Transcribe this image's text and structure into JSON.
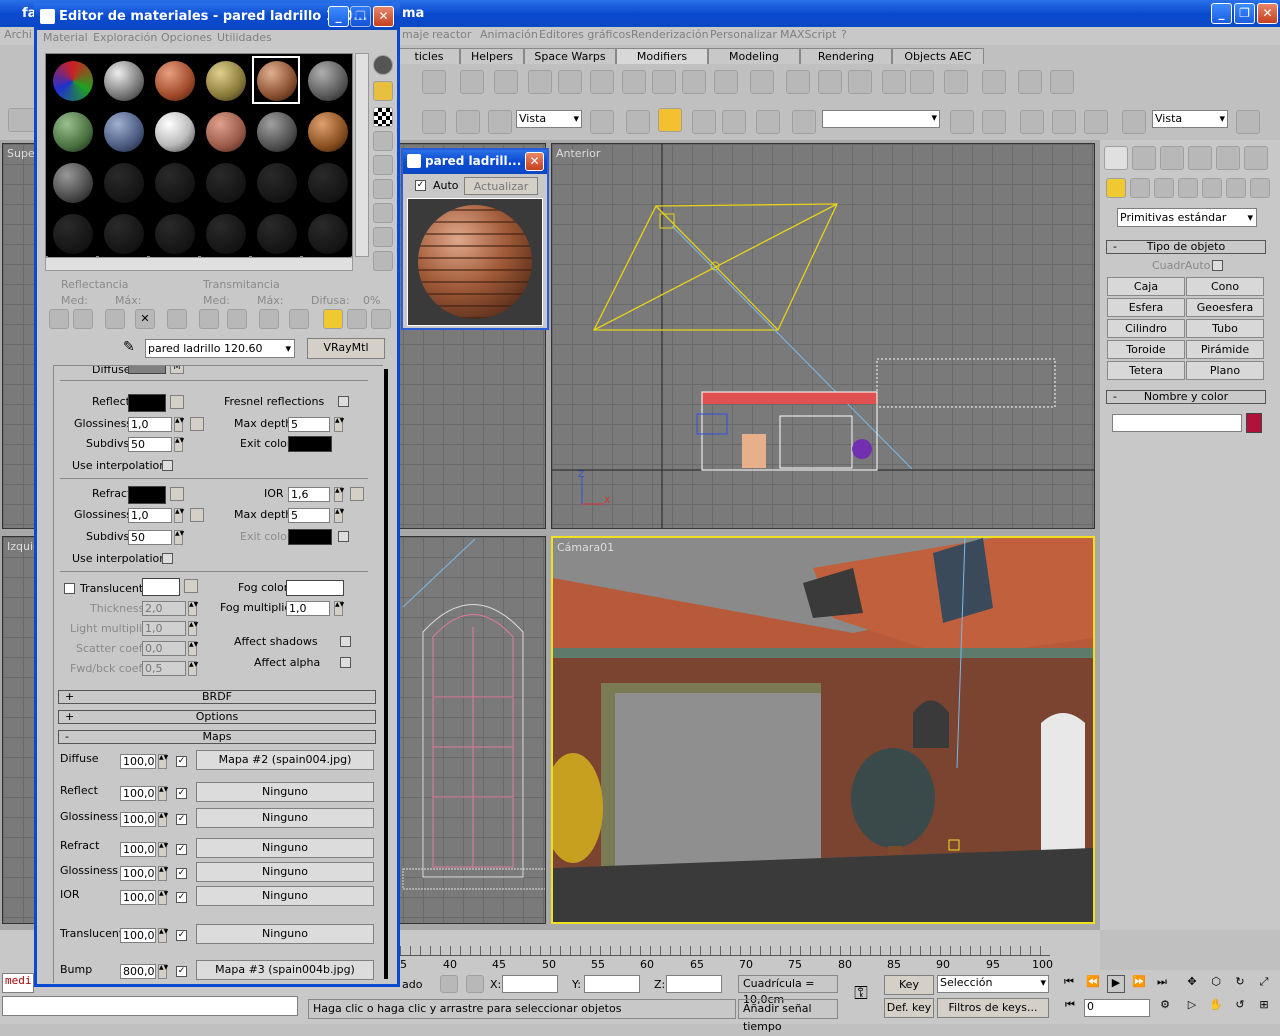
{
  "app": {
    "title_left": "fa",
    "title_right": "ma",
    "menu": [
      "Archi",
      "maje",
      "reactor",
      "Animación",
      "Editores gráficos",
      "Renderización",
      "Personalizar",
      "MAXScript",
      "?"
    ]
  },
  "tabs": [
    "ticles",
    "Helpers",
    "Space Warps",
    "Modifiers",
    "Modeling",
    "Rendering",
    "Objects AEC"
  ],
  "toolbar": {
    "view_select": "Vista",
    "view_select2": "Vista",
    "named_sel": ""
  },
  "viewports": {
    "top_left": "Super",
    "left": "Izquie",
    "front": "Anterior",
    "camera": "Cámara01",
    "axis_z": "Z",
    "axis_x": "X"
  },
  "cmdpanel": {
    "dropdown": "Primitivas estándar",
    "object_type_header": "Tipo de objeto",
    "autogrid": "CuadrAuto",
    "buttons": [
      "Caja",
      "Cono",
      "Esfera",
      "Geoesfera",
      "Cilindro",
      "Tubo",
      "Toroide",
      "Pirámide",
      "Tetera",
      "Plano"
    ],
    "name_color_header": "Nombre y color",
    "accent_color": "#b0123a"
  },
  "material_editor": {
    "title": "Editor de materiales - pared ladrillo 120...",
    "menu": [
      "Material",
      "Exploración",
      "Opciones",
      "Utilidades"
    ],
    "reflectance_label": "Reflectancia",
    "transmittance_label": "Transmitancia",
    "med": "Med:",
    "max": "Máx:",
    "difusa": "Difusa:",
    "difusa_val": "0%",
    "material_name": "pared ladrillo 120.60",
    "material_type": "VRayMtl",
    "diffuse_label": "Diffuse",
    "diffuse_m": "M",
    "reflect": {
      "label": "Reflect",
      "gloss_label": "Glossiness",
      "gloss": "1,0",
      "subdivs_label": "Subdivs",
      "subdivs": "50",
      "interp": "Use interpolation",
      "fresnel": "Fresnel reflections",
      "maxdepth_label": "Max depth",
      "maxdepth": "5",
      "exit_label": "Exit color"
    },
    "refract": {
      "label": "Refract",
      "gloss_label": "Glossiness",
      "gloss": "1,0",
      "subdivs_label": "Subdivs",
      "subdivs": "50",
      "interp": "Use interpolation",
      "ior_label": "IOR",
      "ior": "1,6",
      "maxdepth_label": "Max depth",
      "maxdepth": "5",
      "exit_label": "Exit color"
    },
    "translucent": {
      "label": "Translucent",
      "thickness_label": "Thickness",
      "thickness": "2,0",
      "light_mult_label": "Light multiplier",
      "light_mult": "1,0",
      "scatter_label": "Scatter coeff",
      "scatter": "0,0",
      "fwdbck_label": "Fwd/bck coeff",
      "fwdbck": "0,5",
      "fog_color_label": "Fog color",
      "fog_mult_label": "Fog multiplier",
      "fog_mult": "1,0",
      "affect_shadows": "Affect shadows",
      "affect_alpha": "Affect alpha"
    },
    "rollouts": {
      "brdf": "BRDF",
      "options": "Options",
      "maps": "Maps",
      "plus": "+",
      "minus": "-"
    },
    "maps": [
      {
        "label": "Diffuse",
        "amount": "100,0",
        "map": "Mapa #2 (spain004.jpg)"
      },
      {
        "label": "Reflect",
        "amount": "100,0",
        "map": "Ninguno"
      },
      {
        "label": "Glossiness",
        "amount": "100,0",
        "map": "Ninguno"
      },
      {
        "label": "Refract",
        "amount": "100,0",
        "map": "Ninguno"
      },
      {
        "label": "Glossiness",
        "amount": "100,0",
        "map": "Ninguno"
      },
      {
        "label": "IOR",
        "amount": "100,0",
        "map": "Ninguno"
      },
      {
        "label": "Translucent",
        "amount": "100,0",
        "map": "Ninguno"
      },
      {
        "label": "Bump",
        "amount": "800,0",
        "map": "Mapa #3 (spain004b.jpg)"
      }
    ]
  },
  "preview": {
    "title": "pared ladrill...",
    "auto": "Auto",
    "update": "Actualizar"
  },
  "timeline": {
    "ticks": [
      "5",
      "40",
      "45",
      "50",
      "55",
      "60",
      "65",
      "70",
      "75",
      "80",
      "85",
      "90",
      "95",
      "100"
    ]
  },
  "statusbar": {
    "mini": "medi",
    "ado": "ado",
    "x": "X:",
    "y": "Y:",
    "z": "Z:",
    "grid": "Cuadrícula = 10,0cm",
    "prompt": "Haga clic o haga clic y arrastre para seleccionar objetos",
    "add_time": "Añadir señal tiempo",
    "key_auto": "Key auto",
    "selection": "Selección",
    "def_key": "Def. key",
    "key_filters": "Filtros de keys...",
    "frame": "0"
  }
}
